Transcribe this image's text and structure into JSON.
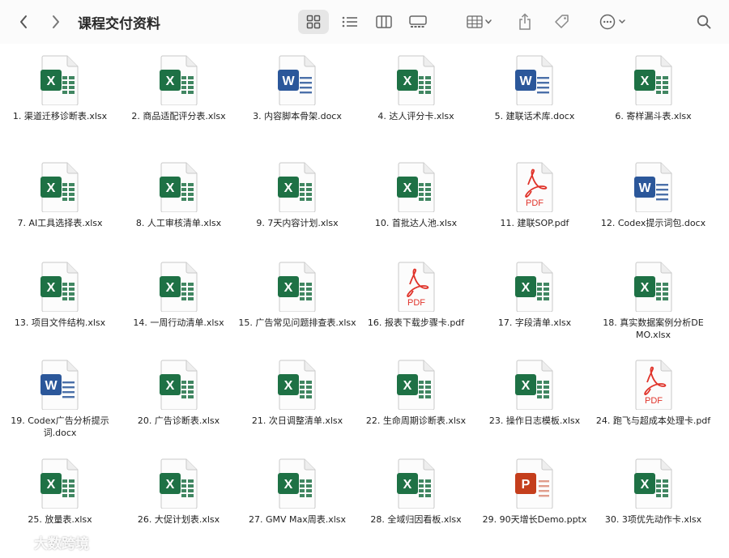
{
  "window": {
    "title": "课程交付资料"
  },
  "toolbar": {
    "back_icon": "chevron-left-icon",
    "forward_icon": "chevron-right-icon",
    "view_modes": [
      "icon-view",
      "list-view",
      "column-view",
      "gallery-view"
    ],
    "active_view": "icon-view",
    "group_icon": "group-by-icon",
    "share_icon": "share-icon",
    "tag_icon": "tag-icon",
    "more_icon": "ellipsis-circle-icon",
    "search_icon": "search-icon"
  },
  "files": [
    {
      "name": "1. 渠道迁移诊断表.xlsx",
      "type": "xlsx"
    },
    {
      "name": "2. 商品适配评分表.xlsx",
      "type": "xlsx"
    },
    {
      "name": "3. 内容脚本骨架.docx",
      "type": "docx"
    },
    {
      "name": "4. 达人评分卡.xlsx",
      "type": "xlsx"
    },
    {
      "name": "5. 建联话术库.docx",
      "type": "docx"
    },
    {
      "name": "6. 寄样漏斗表.xlsx",
      "type": "xlsx"
    },
    {
      "name": "7. AI工具选择表.xlsx",
      "type": "xlsx"
    },
    {
      "name": "8. 人工审核清单.xlsx",
      "type": "xlsx"
    },
    {
      "name": "9. 7天内容计划.xlsx",
      "type": "xlsx"
    },
    {
      "name": "10. 首批达人池.xlsx",
      "type": "xlsx"
    },
    {
      "name": "11. 建联SOP.pdf",
      "type": "pdf"
    },
    {
      "name": "12. Codex提示词包.docx",
      "type": "docx"
    },
    {
      "name": "13. 项目文件结构.xlsx",
      "type": "xlsx"
    },
    {
      "name": "14. 一周行动清单.xlsx",
      "type": "xlsx"
    },
    {
      "name": "15. 广告常见问题排查表.xlsx",
      "type": "xlsx"
    },
    {
      "name": "16. 报表下载步骤卡.pdf",
      "type": "pdf"
    },
    {
      "name": "17. 字段清单.xlsx",
      "type": "xlsx"
    },
    {
      "name": "18. 真实数据案例分析DEMO.xlsx",
      "type": "xlsx"
    },
    {
      "name": "19. Codex广告分析提示词.docx",
      "type": "docx"
    },
    {
      "name": "20. 广告诊断表.xlsx",
      "type": "xlsx"
    },
    {
      "name": "21. 次日调整清单.xlsx",
      "type": "xlsx"
    },
    {
      "name": "22. 生命周期诊断表.xlsx",
      "type": "xlsx"
    },
    {
      "name": "23. 操作日志模板.xlsx",
      "type": "xlsx"
    },
    {
      "name": "24. 跑飞与超成本处理卡.pdf",
      "type": "pdf"
    },
    {
      "name": "25. 放量表.xlsx",
      "type": "xlsx"
    },
    {
      "name": "26. 大促计划表.xlsx",
      "type": "xlsx"
    },
    {
      "name": "27. GMV Max周表.xlsx",
      "type": "xlsx"
    },
    {
      "name": "28. 全域归因看板.xlsx",
      "type": "xlsx"
    },
    {
      "name": "29. 90天增长Demo.pptx",
      "type": "pptx"
    },
    {
      "name": "30. 3项优先动作卡.xlsx",
      "type": "xlsx"
    }
  ],
  "icon_badges": {
    "xlsx": "X",
    "docx": "W",
    "pptx": "P",
    "pdf": "PDF"
  },
  "colors": {
    "xlsx": "#1e7145",
    "docx": "#2b579a",
    "pptx": "#c43e1c",
    "pdf": "#e0332a"
  },
  "watermark": {
    "text": "大数跨境"
  }
}
